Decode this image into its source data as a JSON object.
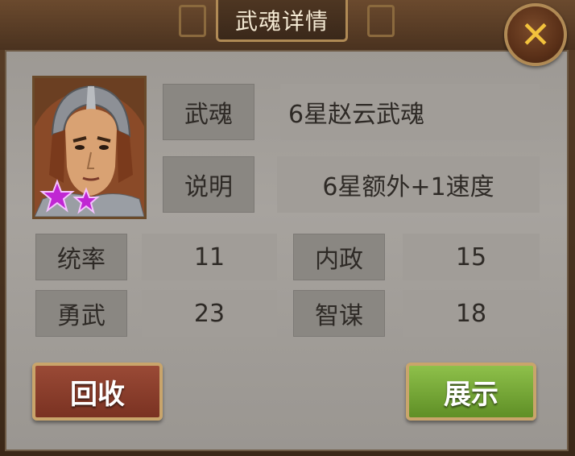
{
  "dialog": {
    "title": "武魂详情",
    "close_icon": "close-x-icon"
  },
  "portrait": {
    "stars": 2,
    "star_color": "#c026d3"
  },
  "info": {
    "name_label": "武魂",
    "name_value": "6星赵云武魂",
    "desc_label": "说明",
    "desc_value": "6星额外+1速度"
  },
  "stats": [
    {
      "label": "统率",
      "value": "11"
    },
    {
      "label": "内政",
      "value": "15"
    },
    {
      "label": "勇武",
      "value": "23"
    },
    {
      "label": "智谋",
      "value": "18"
    }
  ],
  "buttons": {
    "recycle_label": "回收",
    "show_label": "展示"
  },
  "colors": {
    "recycle_button": "#8a3e2c",
    "show_button": "#7aab38",
    "close_x": "#f2c23c"
  }
}
